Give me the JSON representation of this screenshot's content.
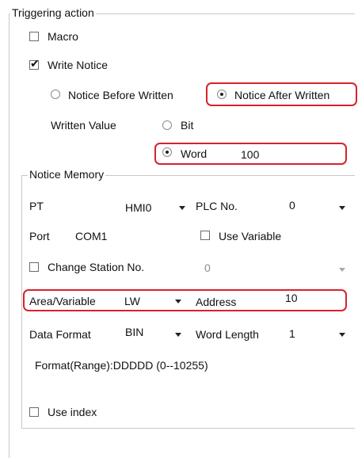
{
  "triggering": {
    "legend": "Triggering action",
    "macro_label": "Macro",
    "macro_checked": false,
    "write_notice_label": "Write Notice",
    "write_notice_checked": true,
    "notice_before_label": "Notice Before Written",
    "notice_after_label": "Notice After Written",
    "notice_selected": "Notice After Written",
    "written_value_label": "Written Value",
    "bit_label": "Bit",
    "word_label": "Word",
    "word_value": "100",
    "written_value_selected": "Word"
  },
  "notice_memory": {
    "legend": "Notice Memory",
    "pt_label": "PT",
    "pt_value": "HMI0",
    "plc_no_label": "PLC No.",
    "plc_no_value": "0",
    "port_label": "Port",
    "port_value": "COM1",
    "use_variable_label": "Use Variable",
    "use_variable_checked": false,
    "change_station_label": "Change Station No.",
    "change_station_checked": false,
    "station_value": "0",
    "area_label": "Area/Variable",
    "area_value": "LW",
    "address_label": "Address",
    "address_value": "10",
    "data_format_label": "Data Format",
    "data_format_value": "BIN",
    "word_length_label": "Word Length",
    "word_length_value": "1",
    "format_range": "Format(Range):DDDDD (0--10255)",
    "use_index_label": "Use index",
    "use_index_checked": false
  },
  "colors": {
    "highlight": "#d6232b",
    "border": "#c8c8c8"
  }
}
